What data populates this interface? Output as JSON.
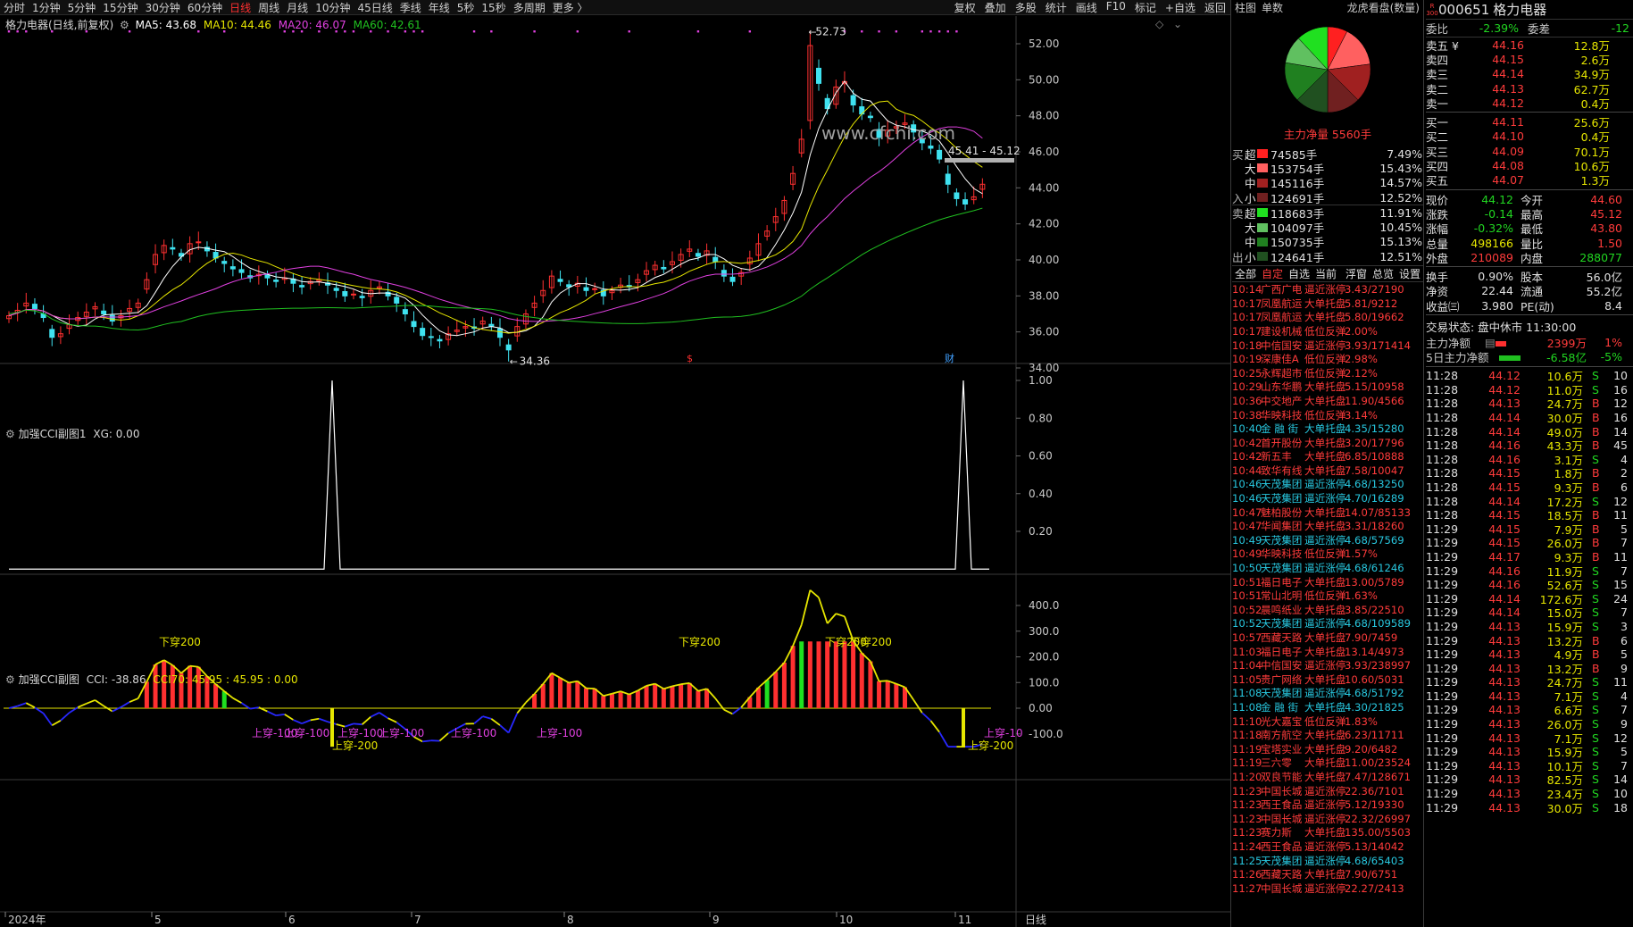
{
  "toolbar": {
    "periods": [
      "分时",
      "1分钟",
      "5分钟",
      "15分钟",
      "30分钟",
      "60分钟",
      "日线",
      "周线",
      "月线",
      "10分钟",
      "45日线",
      "季线",
      "年线",
      "5秒",
      "15秒",
      "多周期",
      "更多 〉"
    ],
    "active_period": "日线",
    "tools": [
      "复权",
      "叠加",
      "多股",
      "统计",
      "画线",
      "F10",
      "标记",
      "+自选",
      "返回"
    ]
  },
  "chart_header": {
    "title": "格力电器(日线,前复权)",
    "ma5": "MA5: 43.68",
    "ma10": "MA10: 44.46",
    "ma20": "MA20: 46.07",
    "ma60": "MA60: 42.61"
  },
  "colors": {
    "up": "#ff3030",
    "down": "#3fe2f0",
    "ma5": "#ffffff",
    "ma10": "#e6e600",
    "ma20": "#e040e0",
    "ma60": "#20c020",
    "cci": "#e6e600",
    "cci_low": "#2828ff",
    "accent": "#ff3b3b"
  },
  "price_axis": [
    "52.00",
    "50.00",
    "48.00",
    "46.00",
    "44.00",
    "42.00",
    "40.00",
    "38.00",
    "36.00",
    "34.00"
  ],
  "annotations": {
    "high": "52.73",
    "low": "34.36",
    "range": "45.41 - 45.12",
    "watermark": "www.cfchi.com",
    "marker_s": "$",
    "marker_cai": "财"
  },
  "sub1": {
    "title": "加强CCI副图1",
    "xg": "XG: 0.00",
    "axis": [
      "1.00",
      "0.80",
      "0.60",
      "0.40",
      "0.20"
    ]
  },
  "sub2": {
    "title": "加强CCI副图",
    "cci": "CCI: -38.86",
    "cci70": "CCI70: 45.95 : 45.95 : 0.00",
    "axis": [
      "400.0",
      "300.0",
      "200.0",
      "100.0",
      "0.00",
      "-100.0"
    ],
    "labels_up": [
      "下穿200",
      "下穿200",
      "下穿200",
      "下穿200"
    ],
    "labels_down": [
      "上穿-100",
      "上穿-100",
      "上穿-100",
      "上穿-100",
      "上穿-100",
      "上穿-100",
      "上穿-10"
    ],
    "labels_200": [
      "上穿-200",
      "上穿-200"
    ]
  },
  "x_axis": [
    "2024年",
    "5",
    "6",
    "7",
    "8",
    "9",
    "10",
    "11",
    "日线"
  ],
  "chart_data": {
    "type": "candlestick",
    "symbol": "000651",
    "name": "格力电器",
    "period": "日线",
    "ylim": [
      34,
      53
    ],
    "high": 52.73,
    "low": 34.36,
    "close_series": [
      36.9,
      37.2,
      37.6,
      37.3,
      36.8,
      35.7,
      35.9,
      36.4,
      36.8,
      37.1,
      37.4,
      37.0,
      36.6,
      36.9,
      37.3,
      37.6,
      38.9,
      40.3,
      40.8,
      40.6,
      40.2,
      40.9,
      41.0,
      40.5,
      40.1,
      39.8,
      39.5,
      39.3,
      39.0,
      39.2,
      39.0,
      38.8,
      39.0,
      38.7,
      38.5,
      38.8,
      38.9,
      38.6,
      38.3,
      38.0,
      38.1,
      37.9,
      38.3,
      38.5,
      38.0,
      37.6,
      37.0,
      36.3,
      35.8,
      35.7,
      35.5,
      35.9,
      36.1,
      36.3,
      36.2,
      36.6,
      36.3,
      35.7,
      35.0,
      36.3,
      37.0,
      37.6,
      38.3,
      39.1,
      38.8,
      38.5,
      38.7,
      38.3,
      38.4,
      38.0,
      38.3,
      38.6,
      38.5,
      38.9,
      39.4,
      39.7,
      39.5,
      39.9,
      40.3,
      40.6,
      40.2,
      40.5,
      39.9,
      39.1,
      38.8,
      39.3,
      40.1,
      40.9,
      41.6,
      42.4,
      43.3,
      44.8,
      46.7,
      51.9,
      49.8,
      48.4,
      49.6,
      49.9,
      48.6,
      48.1,
      47.9,
      46.8,
      47.2,
      47.4,
      47.6,
      47.1,
      46.5,
      46.2,
      45.6,
      44.2,
      43.4,
      43.1,
      43.5,
      44.2
    ]
  },
  "pie": {
    "tabs": [
      "柱图",
      "单数"
    ],
    "title": "龙虎看盘(数量)",
    "net": "主力净量 5560手"
  },
  "flows": {
    "buy_label": "买",
    "buy_in": "入",
    "sell_label": "卖",
    "sell_out": "出",
    "buy": [
      {
        "lv": "超",
        "v": "74585手",
        "p": "7.49%",
        "c": "#ff2020"
      },
      {
        "lv": "大",
        "v": "153754手",
        "p": "15.43%",
        "c": "#ff6060"
      },
      {
        "lv": "中",
        "v": "145116手",
        "p": "14.57%",
        "c": "#a02020"
      },
      {
        "lv": "小",
        "v": "124691手",
        "p": "12.52%",
        "c": "#702020"
      }
    ],
    "sell": [
      {
        "lv": "超",
        "v": "118683手",
        "p": "11.91%",
        "c": "#20e020"
      },
      {
        "lv": "大",
        "v": "104097手",
        "p": "10.45%",
        "c": "#60c060"
      },
      {
        "lv": "中",
        "v": "150735手",
        "p": "15.13%",
        "c": "#208020"
      },
      {
        "lv": "小",
        "v": "124641手",
        "p": "12.51%",
        "c": "#205020"
      }
    ]
  },
  "news_tabs": [
    "全部",
    "自定",
    "自选",
    "当前",
    "浮窗",
    "总览",
    "设置"
  ],
  "news": [
    [
      "10:14",
      "广西广电",
      "逼近涨停",
      "3.43/27190",
      "r"
    ],
    [
      "10:17",
      "凤凰航运",
      "大单托盘",
      "5.81/9212",
      "r"
    ],
    [
      "10:17",
      "凤凰航运",
      "大单托盘",
      "5.80/19662",
      "r"
    ],
    [
      "10:17",
      "建设机械",
      "低位反弹",
      "2.00%",
      "r"
    ],
    [
      "10:18",
      "中信国安",
      "逼近涨停",
      "3.93/171414",
      "r"
    ],
    [
      "10:19",
      "深康佳A",
      "低位反弹",
      "2.98%",
      "r"
    ],
    [
      "10:25",
      "永辉超市",
      "低位反弹",
      "2.12%",
      "r"
    ],
    [
      "10:29",
      "山东华鹏",
      "大单托盘",
      "5.15/10958",
      "r"
    ],
    [
      "10:36",
      "中交地产",
      "大单托盘",
      "11.90/4566",
      "r"
    ],
    [
      "10:38",
      "华映科技",
      "低位反弹",
      "3.14%",
      "r"
    ],
    [
      "10:40",
      "金 融 街",
      "大单托盘",
      "4.35/15280",
      "c"
    ],
    [
      "10:42",
      "首开股份",
      "大单托盘",
      "3.20/17796",
      "r"
    ],
    [
      "10:42",
      "新五丰",
      "大单托盘",
      "6.85/10888",
      "r"
    ],
    [
      "10:44",
      "致华有线",
      "大单托盘",
      "7.58/10047",
      "r"
    ],
    [
      "10:46",
      "天茂集团",
      "逼近涨停",
      "4.68/13250",
      "c"
    ],
    [
      "10:46",
      "天茂集团",
      "逼近涨停",
      "4.70/16289",
      "c"
    ],
    [
      "10:47",
      "魅柏股份",
      "大单托盘",
      "14.07/85133",
      "r"
    ],
    [
      "10:47",
      "华闻集团",
      "大单托盘",
      "3.31/18260",
      "r"
    ],
    [
      "10:49",
      "天茂集团",
      "逼近涨停",
      "4.68/57569",
      "c"
    ],
    [
      "10:49",
      "华映科技",
      "低位反弹",
      "1.57%",
      "r"
    ],
    [
      "10:50",
      "天茂集团",
      "逼近涨停",
      "4.68/61246",
      "c"
    ],
    [
      "10:51",
      "福日电子",
      "大单托盘",
      "13.00/5789",
      "r"
    ],
    [
      "10:51",
      "常山北明",
      "低位反弹",
      "1.63%",
      "r"
    ],
    [
      "10:52",
      "晨鸣纸业",
      "大单托盘",
      "3.85/22510",
      "r"
    ],
    [
      "10:52",
      "天茂集团",
      "逼近涨停",
      "4.68/109589",
      "c"
    ],
    [
      "10:57",
      "西藏天路",
      "大单托盘",
      "7.90/7459",
      "r"
    ],
    [
      "11:03",
      "福日电子",
      "大单托盘",
      "13.14/4973",
      "r"
    ],
    [
      "11:04",
      "中信国安",
      "逼近涨停",
      "3.93/238997",
      "r"
    ],
    [
      "11:05",
      "贵广网络",
      "大单托盘",
      "10.60/5031",
      "r"
    ],
    [
      "11:08",
      "天茂集团",
      "逼近涨停",
      "4.68/51792",
      "c"
    ],
    [
      "11:08",
      "金 融 街",
      "大单托盘",
      "4.30/21825",
      "c"
    ],
    [
      "11:10",
      "光大嘉宝",
      "低位反弹",
      "1.83%",
      "r"
    ],
    [
      "11:18",
      "南方航空",
      "大单托盘",
      "6.23/11711",
      "r"
    ],
    [
      "11:19",
      "宝塔实业",
      "大单托盘",
      "9.20/6482",
      "r"
    ],
    [
      "11:19",
      "三六零",
      "大单托盘",
      "11.00/23524",
      "r"
    ],
    [
      "11:20",
      "双良节能",
      "大单托盘",
      "7.47/128671",
      "r"
    ],
    [
      "11:23",
      "中国长城",
      "逼近涨停",
      "22.36/7101",
      "r"
    ],
    [
      "11:23",
      "西王食品",
      "逼近涨停",
      "5.12/19330",
      "r"
    ],
    [
      "11:23",
      "中国长城",
      "逼近涨停",
      "22.32/26997",
      "r"
    ],
    [
      "11:23",
      "赛力斯",
      "大单托盘",
      "135.00/5503",
      "r"
    ],
    [
      "11:24",
      "西王食品",
      "逼近涨停",
      "5.13/14042",
      "r"
    ],
    [
      "11:25",
      "天茂集团",
      "逼近涨停",
      "4.68/65403",
      "c"
    ],
    [
      "11:26",
      "西藏天路",
      "大单托盘",
      "7.90/6751",
      "r"
    ],
    [
      "11:27",
      "中国长城",
      "逼近涨停",
      "22.27/2413",
      "r"
    ]
  ],
  "quote": {
    "code": "000651",
    "name": "格力电器",
    "logo": "R\n300",
    "weibi": "委比",
    "weibi_v": "-2.39%",
    "weicha": "委差",
    "weicha_v": "-12",
    "asks": [
      [
        "卖五 ¥",
        "44.16",
        "12.8万"
      ],
      [
        "卖四",
        "44.15",
        "2.6万"
      ],
      [
        "卖三",
        "44.14",
        "34.9万"
      ],
      [
        "卖二",
        "44.13",
        "62.7万"
      ],
      [
        "卖一",
        "44.12",
        "0.4万"
      ]
    ],
    "bids": [
      [
        "买一",
        "44.11",
        "25.6万"
      ],
      [
        "买二",
        "44.10",
        "0.4万"
      ],
      [
        "买三",
        "44.09",
        "70.1万"
      ],
      [
        "买四",
        "44.08",
        "10.6万"
      ],
      [
        "买五",
        "44.07",
        "1.3万"
      ]
    ],
    "stats": [
      [
        "现价",
        "44.12",
        "今开",
        "44.60"
      ],
      [
        "涨跌",
        "-0.14",
        "最高",
        "45.12"
      ],
      [
        "涨幅",
        "-0.32%",
        "最低",
        "43.80"
      ],
      [
        "总量",
        "498166",
        "量比",
        "1.50"
      ],
      [
        "外盘",
        "210089",
        "内盘",
        "288077"
      ]
    ],
    "stats2": [
      [
        "换手",
        "0.90%",
        "股本",
        "56.0亿"
      ],
      [
        "净资",
        "22.44",
        "流通",
        "55.2亿"
      ],
      [
        "收益㈢",
        "3.980",
        "PE(动)",
        "8.4"
      ]
    ],
    "status": "交易状态: 盘中休市 11:30:00",
    "main_net": "主力净额",
    "main_net_v": "2399万",
    "main_net_p": "1%",
    "net5": "5日主力净额",
    "net5_v": "-6.58亿",
    "net5_p": "-5%"
  },
  "ticks": [
    [
      "11:28",
      "44.12",
      "10.6万",
      "S",
      "10"
    ],
    [
      "11:28",
      "44.12",
      "11.0万",
      "S",
      "16"
    ],
    [
      "11:28",
      "44.13",
      "24.7万",
      "B",
      "12"
    ],
    [
      "11:28",
      "44.14",
      "30.0万",
      "B",
      "16"
    ],
    [
      "11:28",
      "44.14",
      "49.0万",
      "B",
      "14"
    ],
    [
      "11:28",
      "44.16",
      "43.3万",
      "B",
      "45"
    ],
    [
      "11:28",
      "44.16",
      "3.1万",
      "S",
      "4"
    ],
    [
      "11:28",
      "44.15",
      "1.8万",
      "B",
      "2"
    ],
    [
      "11:28",
      "44.15",
      "9.3万",
      "B",
      "6"
    ],
    [
      "11:28",
      "44.14",
      "17.2万",
      "S",
      "12"
    ],
    [
      "11:28",
      "44.15",
      "18.5万",
      "B",
      "11"
    ],
    [
      "11:29",
      "44.15",
      "7.9万",
      "B",
      "5"
    ],
    [
      "11:29",
      "44.15",
      "26.0万",
      "B",
      "7"
    ],
    [
      "11:29",
      "44.17",
      "9.3万",
      "B",
      "11"
    ],
    [
      "11:29",
      "44.16",
      "11.9万",
      "S",
      "7"
    ],
    [
      "11:29",
      "44.16",
      "52.6万",
      "S",
      "15"
    ],
    [
      "11:29",
      "44.14",
      "172.6万",
      "S",
      "24"
    ],
    [
      "11:29",
      "44.14",
      "15.0万",
      "S",
      "7"
    ],
    [
      "11:29",
      "44.13",
      "15.9万",
      "S",
      "3"
    ],
    [
      "11:29",
      "44.13",
      "13.2万",
      "B",
      "6"
    ],
    [
      "11:29",
      "44.13",
      "4.9万",
      "B",
      "5"
    ],
    [
      "11:29",
      "44.13",
      "13.2万",
      "B",
      "9"
    ],
    [
      "11:29",
      "44.13",
      "24.7万",
      "S",
      "11"
    ],
    [
      "11:29",
      "44.13",
      "7.1万",
      "S",
      "4"
    ],
    [
      "11:29",
      "44.13",
      "6.6万",
      "S",
      "7"
    ],
    [
      "11:29",
      "44.13",
      "26.0万",
      "S",
      "9"
    ],
    [
      "11:29",
      "44.13",
      "7.1万",
      "S",
      "12"
    ],
    [
      "11:29",
      "44.13",
      "15.9万",
      "S",
      "5"
    ],
    [
      "11:29",
      "44.13",
      "10.1万",
      "S",
      "7"
    ],
    [
      "11:29",
      "44.13",
      "82.5万",
      "S",
      "14"
    ],
    [
      "11:29",
      "44.13",
      "23.4万",
      "S",
      "10"
    ],
    [
      "11:29",
      "44.13",
      "30.0万",
      "S",
      "18"
    ]
  ]
}
